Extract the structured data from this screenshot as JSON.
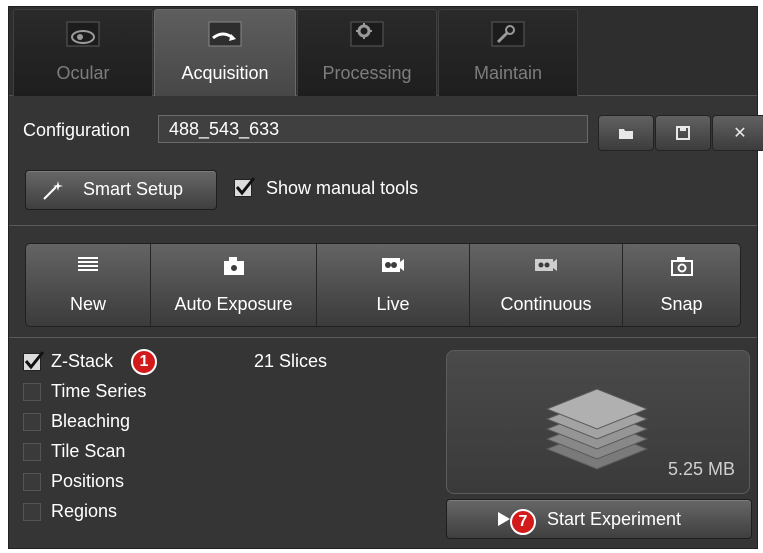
{
  "tabs": [
    {
      "label": "Ocular",
      "icon": "eye-icon",
      "active": false
    },
    {
      "label": "Acquisition",
      "icon": "acquisition-icon",
      "active": true
    },
    {
      "label": "Processing",
      "icon": "gear-icon",
      "active": false
    },
    {
      "label": "Maintain",
      "icon": "wrench-icon",
      "active": false
    }
  ],
  "config": {
    "label": "Configuration",
    "value": "488_543_633"
  },
  "smart_setup": {
    "label": "Smart Setup"
  },
  "show_manual_tools": {
    "label": "Show manual tools",
    "checked": true
  },
  "actions": [
    {
      "label": "New",
      "icon": "list-icon"
    },
    {
      "label": "Auto Exposure",
      "icon": "camera-icon"
    },
    {
      "label": "Live",
      "icon": "video-camera-icon"
    },
    {
      "label": "Continuous",
      "icon": "continuous-camera-icon"
    },
    {
      "label": "Snap",
      "icon": "snap-camera-icon"
    }
  ],
  "options": [
    {
      "label": "Z-Stack",
      "checked": true
    },
    {
      "label": "Time Series",
      "checked": false
    },
    {
      "label": "Bleaching",
      "checked": false
    },
    {
      "label": "Tile Scan",
      "checked": false
    },
    {
      "label": "Positions",
      "checked": false
    },
    {
      "label": "Regions",
      "checked": false
    }
  ],
  "slices": "21 Slices",
  "preview": {
    "size": "5.25 MB"
  },
  "start_experiment": {
    "label": "Start Experiment"
  },
  "badges": {
    "z_stack": "1",
    "start": "7"
  },
  "colors": {
    "badge": "#d31a1a",
    "panel": "#353535",
    "active_tab": "#5a5a5a"
  }
}
